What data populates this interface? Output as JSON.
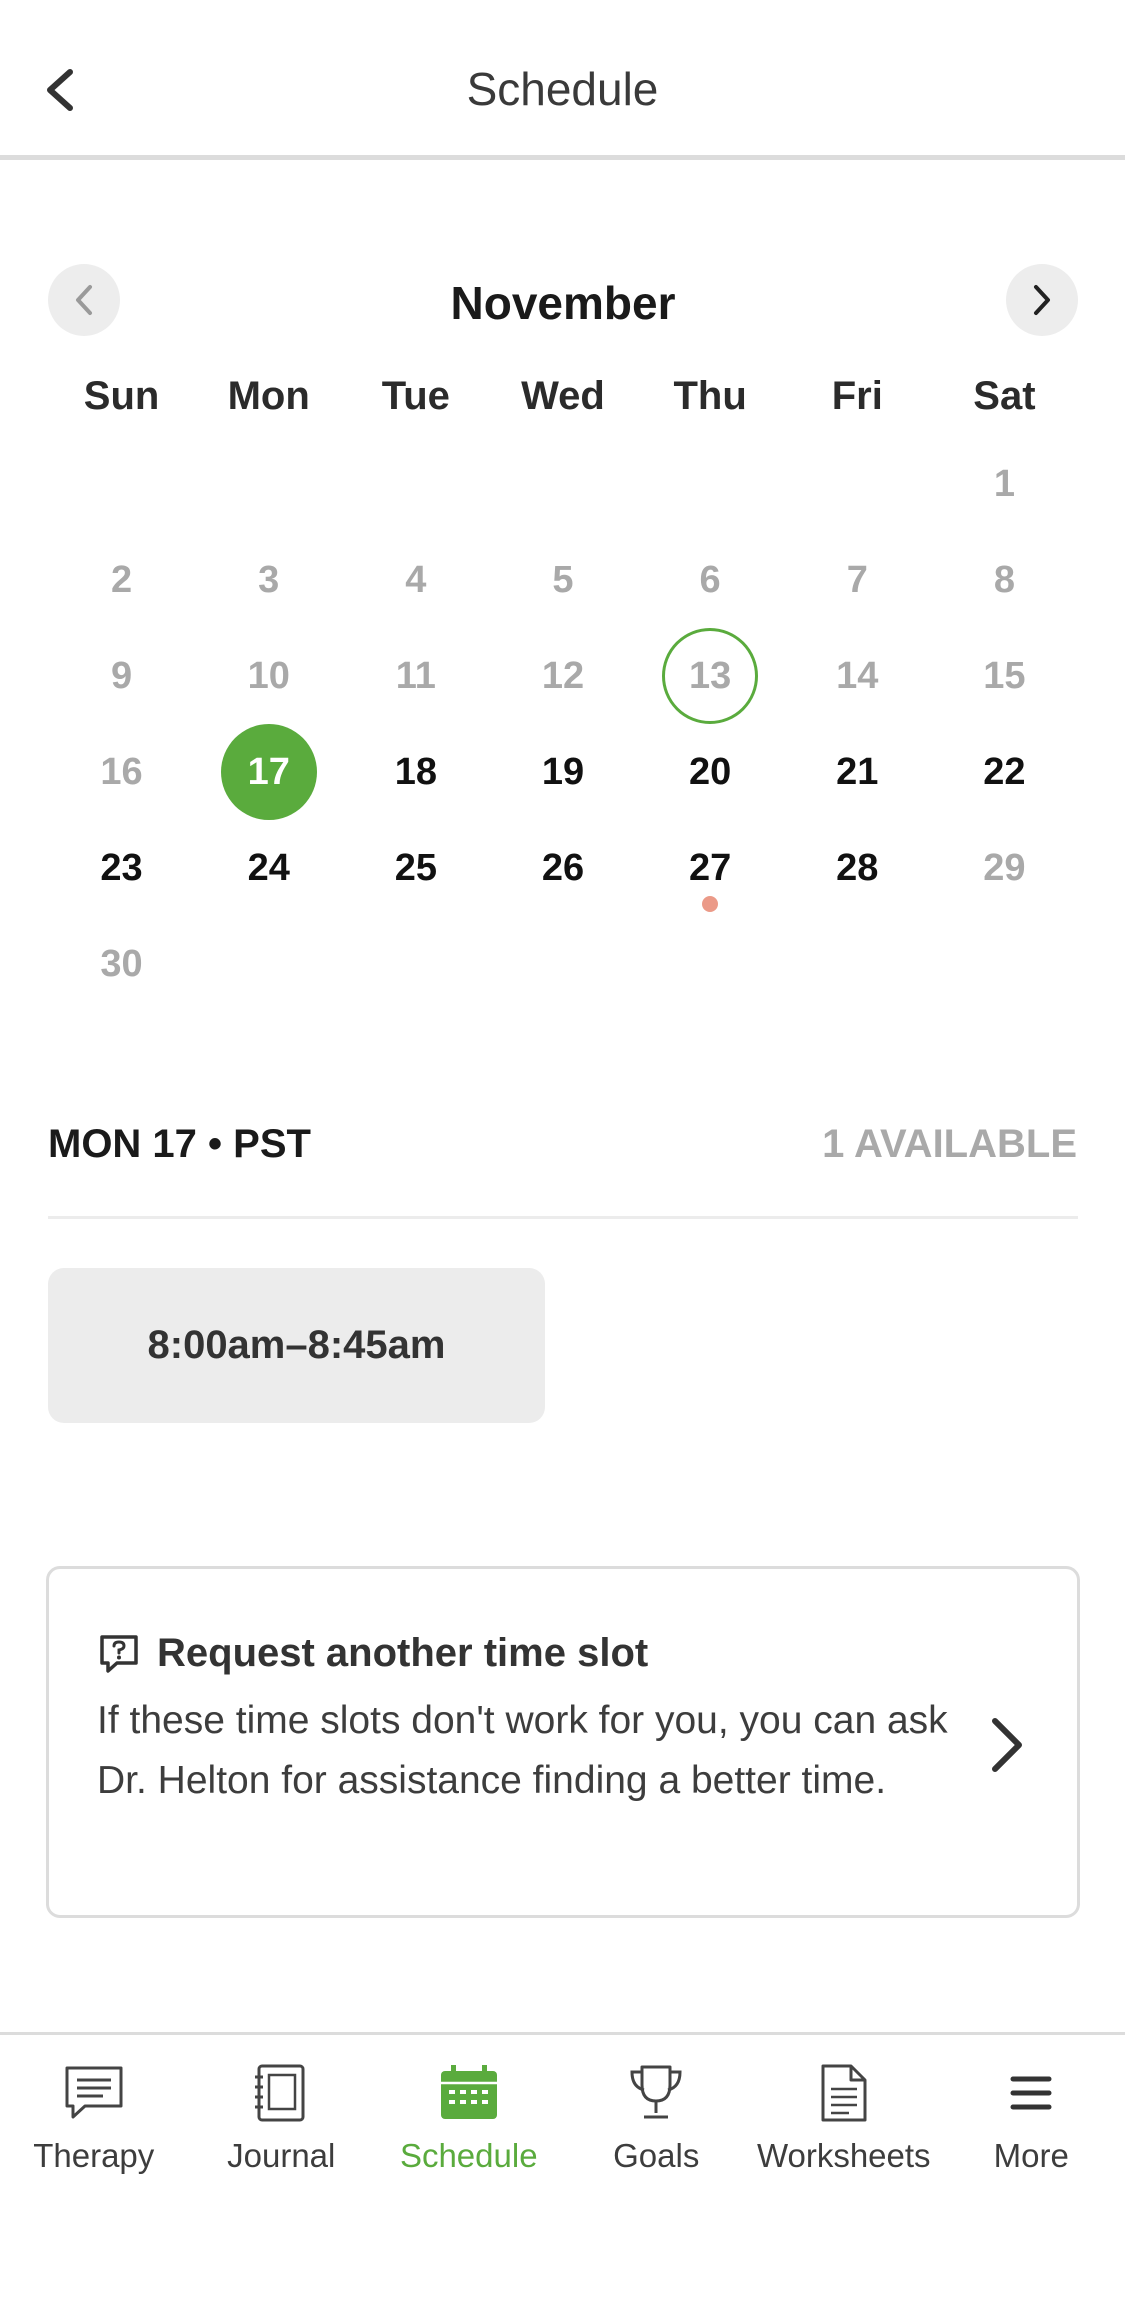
{
  "header": {
    "title": "Schedule"
  },
  "calendar": {
    "month": "November",
    "weekdays": [
      "Sun",
      "Mon",
      "Tue",
      "Wed",
      "Thu",
      "Fri",
      "Sat"
    ],
    "leading_blanks": 6,
    "days": [
      {
        "n": "1",
        "state": "muted"
      },
      {
        "n": "2",
        "state": "muted"
      },
      {
        "n": "3",
        "state": "muted"
      },
      {
        "n": "4",
        "state": "muted"
      },
      {
        "n": "5",
        "state": "muted"
      },
      {
        "n": "6",
        "state": "muted"
      },
      {
        "n": "7",
        "state": "muted"
      },
      {
        "n": "8",
        "state": "muted"
      },
      {
        "n": "9",
        "state": "muted"
      },
      {
        "n": "10",
        "state": "muted"
      },
      {
        "n": "11",
        "state": "muted"
      },
      {
        "n": "12",
        "state": "muted"
      },
      {
        "n": "13",
        "state": "today"
      },
      {
        "n": "14",
        "state": "muted"
      },
      {
        "n": "15",
        "state": "muted"
      },
      {
        "n": "16",
        "state": "muted"
      },
      {
        "n": "17",
        "state": "selected"
      },
      {
        "n": "18",
        "state": "active"
      },
      {
        "n": "19",
        "state": "active"
      },
      {
        "n": "20",
        "state": "active"
      },
      {
        "n": "21",
        "state": "active"
      },
      {
        "n": "22",
        "state": "active"
      },
      {
        "n": "23",
        "state": "active"
      },
      {
        "n": "24",
        "state": "active"
      },
      {
        "n": "25",
        "state": "active"
      },
      {
        "n": "26",
        "state": "active"
      },
      {
        "n": "27",
        "state": "active",
        "dot": true
      },
      {
        "n": "28",
        "state": "active"
      },
      {
        "n": "29",
        "state": "muted"
      },
      {
        "n": "30",
        "state": "muted"
      }
    ]
  },
  "selection": {
    "date_label": "MON 17 • PST",
    "available_label": "1 AVAILABLE",
    "slots": [
      "8:00am–8:45am"
    ]
  },
  "request_card": {
    "title": "Request another time slot",
    "text": "If these time slots don't work for you, you can ask Dr. Helton for assistance finding a better time."
  },
  "bottom_nav": {
    "items": [
      {
        "label": "Therapy",
        "icon": "chat-icon",
        "active": false
      },
      {
        "label": "Journal",
        "icon": "journal-icon",
        "active": false
      },
      {
        "label": "Schedule",
        "icon": "calendar-icon",
        "active": true
      },
      {
        "label": "Goals",
        "icon": "trophy-icon",
        "active": false
      },
      {
        "label": "Worksheets",
        "icon": "document-icon",
        "active": false
      },
      {
        "label": "More",
        "icon": "menu-icon",
        "active": false
      }
    ]
  },
  "colors": {
    "accent": "#5aab3d",
    "muted": "#a9a9a9",
    "event_dot": "#eb9a88",
    "slot_bg": "#ececec"
  }
}
